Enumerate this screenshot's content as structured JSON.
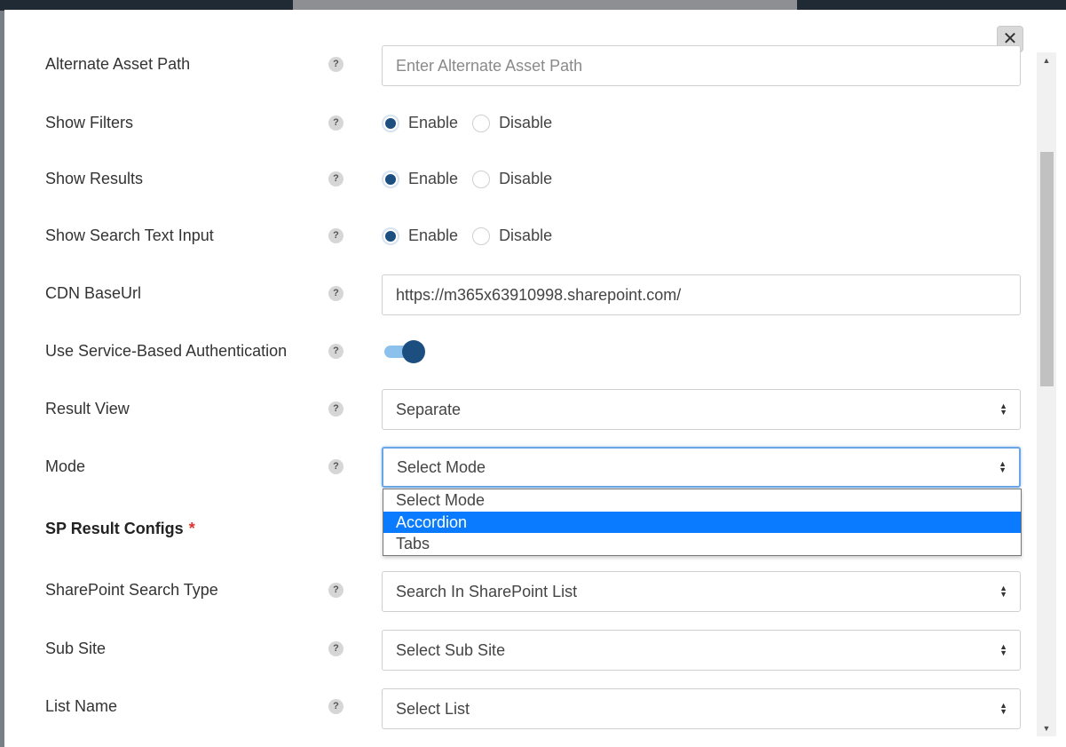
{
  "form": {
    "alternate_asset_path": {
      "label": "Alternate Asset Path",
      "placeholder": "Enter Alternate Asset Path"
    },
    "show_filters": {
      "label": "Show Filters",
      "enable": "Enable",
      "disable": "Disable",
      "selected": "Enable"
    },
    "show_results": {
      "label": "Show Results",
      "enable": "Enable",
      "disable": "Disable",
      "selected": "Enable"
    },
    "show_search_text_input": {
      "label": "Show Search Text Input",
      "enable": "Enable",
      "disable": "Disable",
      "selected": "Enable"
    },
    "cdn_base_url": {
      "label": "CDN BaseUrl",
      "value": "https://m365x63910998.sharepoint.com/"
    },
    "service_auth": {
      "label": "Use Service-Based Authentication",
      "on": true
    },
    "result_view": {
      "label": "Result View",
      "value": "Separate"
    },
    "mode": {
      "label": "Mode",
      "value": "Select Mode",
      "options": [
        "Select Mode",
        "Accordion",
        "Tabs"
      ],
      "highlighted": "Accordion"
    },
    "sp_result_configs": {
      "label": "SP Result Configs",
      "required_mark": "*"
    },
    "sharepoint_search_type": {
      "label": "SharePoint Search Type",
      "value": "Search In SharePoint List"
    },
    "sub_site": {
      "label": "Sub Site",
      "value": "Select Sub Site"
    },
    "list_name": {
      "label": "List Name",
      "value": "Select List"
    }
  },
  "help_symbol": "?",
  "close_symbol": "✕",
  "colors": {
    "accent": "#1c4f80",
    "toggle_track": "#8cc1ee",
    "option_highlight": "#0a7bff",
    "required": "#e03030"
  }
}
